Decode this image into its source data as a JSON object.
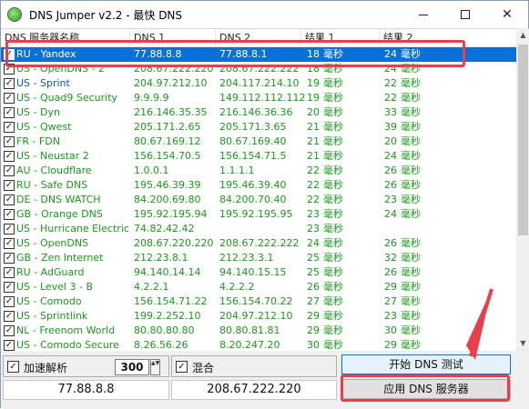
{
  "window": {
    "title": "DNS Jumper v2.2 - 最快 DNS",
    "min_label": "",
    "max_label": "",
    "close_label": "✕"
  },
  "columns": {
    "name": "DNS 服务器名称",
    "dns1": "DNS 1",
    "dns2": "DNS 2",
    "result1": "结果 1",
    "result2": "结果 2"
  },
  "rows": [
    {
      "name": "RU - Yandex",
      "dns1": "77.88.8.8",
      "dns2": "77.88.8.1",
      "r1": "18",
      "r1u": "毫秒",
      "r2": "24",
      "r2u": "毫秒",
      "checked": true,
      "selected": true
    },
    {
      "name": "US - OpenDNS - 2",
      "dns1": "208.67.222.220",
      "dns2": "208.67.222.222",
      "r1": "18",
      "r1u": "毫秒",
      "r2": "24",
      "r2u": "毫秒",
      "checked": true
    },
    {
      "name": "US - Sprint",
      "dns1": "204.97.212.10",
      "dns2": "204.117.214.10",
      "r1": "19",
      "r1u": "毫秒",
      "r2": "22",
      "r2u": "毫秒",
      "checked": true
    },
    {
      "name": "US - Quad9 Security",
      "dns1": "9.9.9.9",
      "dns2": "149.112.112.112",
      "r1": "19",
      "r1u": "毫秒",
      "r2": "22",
      "r2u": "毫秒",
      "checked": true
    },
    {
      "name": "US - Dyn",
      "dns1": "216.146.35.35",
      "dns2": "216.146.36.36",
      "r1": "20",
      "r1u": "毫秒",
      "r2": "33",
      "r2u": "毫秒",
      "checked": true
    },
    {
      "name": "US - Qwest",
      "dns1": "205.171.2.65",
      "dns2": "205.171.3.65",
      "r1": "21",
      "r1u": "毫秒",
      "r2": "39",
      "r2u": "毫秒",
      "checked": true
    },
    {
      "name": "FR - FDN",
      "dns1": "80.67.169.12",
      "dns2": "80.67.169.40",
      "r1": "21",
      "r1u": "毫秒",
      "r2": "20",
      "r2u": "毫秒",
      "checked": true
    },
    {
      "name": "US - Neustar 2",
      "dns1": "156.154.70.5",
      "dns2": "156.154.71.5",
      "r1": "21",
      "r1u": "毫秒",
      "r2": "24",
      "r2u": "毫秒",
      "checked": true
    },
    {
      "name": "AU - Cloudflare",
      "dns1": "1.0.0.1",
      "dns2": "1.1.1.1",
      "r1": "22",
      "r1u": "毫秒",
      "r2": "26",
      "r2u": "毫秒",
      "checked": true
    },
    {
      "name": "RU - Safe DNS",
      "dns1": "195.46.39.39",
      "dns2": "195.46.39.40",
      "r1": "22",
      "r1u": "毫秒",
      "r2": "26",
      "r2u": "毫秒",
      "checked": true
    },
    {
      "name": "DE - DNS WATCH",
      "dns1": "84.200.69.80",
      "dns2": "84.200.70.40",
      "r1": "22",
      "r1u": "毫秒",
      "r2": "23",
      "r2u": "毫秒",
      "checked": true
    },
    {
      "name": "GB - Orange DNS",
      "dns1": "195.92.195.94",
      "dns2": "195.92.195.95",
      "r1": "23",
      "r1u": "毫秒",
      "r2": "24",
      "r2u": "毫秒",
      "checked": true
    },
    {
      "name": "US - Hurricane Electric",
      "dns1": "74.82.42.42",
      "dns2": "",
      "r1": "23",
      "r1u": "毫秒",
      "r2": "",
      "r2u": "",
      "checked": true
    },
    {
      "name": "US - OpenDNS",
      "dns1": "208.67.220.220",
      "dns2": "208.67.222.222",
      "r1": "24",
      "r1u": "毫秒",
      "r2": "26",
      "r2u": "毫秒",
      "checked": true
    },
    {
      "name": "GB - Zen Internet",
      "dns1": "212.23.8.1",
      "dns2": "212.23.3.1",
      "r1": "25",
      "r1u": "毫秒",
      "r2": "32",
      "r2u": "毫秒",
      "checked": true
    },
    {
      "name": "RU - AdGuard",
      "dns1": "94.140.14.14",
      "dns2": "94.140.15.15",
      "r1": "25",
      "r1u": "毫秒",
      "r2": "26",
      "r2u": "毫秒",
      "checked": true
    },
    {
      "name": "US - Level 3 - B",
      "dns1": "4.2.2.1",
      "dns2": "4.2.2.2",
      "r1": "26",
      "r1u": "毫秒",
      "r2": "29",
      "r2u": "毫秒",
      "checked": true
    },
    {
      "name": "US - Comodo",
      "dns1": "156.154.71.22",
      "dns2": "156.154.70.22",
      "r1": "27",
      "r1u": "毫秒",
      "r2": "27",
      "r2u": "毫秒",
      "checked": true
    },
    {
      "name": "US - Sprintlink",
      "dns1": "199.2.252.10",
      "dns2": "204.97.212.10",
      "r1": "29",
      "r1u": "毫秒",
      "r2": "23",
      "r2u": "毫秒",
      "checked": true
    },
    {
      "name": "NL - Freenom World",
      "dns1": "80.80.80.80",
      "dns2": "80.80.81.81",
      "r1": "29",
      "r1u": "毫秒",
      "r2": "30",
      "r2u": "毫秒",
      "checked": true
    },
    {
      "name": "US - Comodo Secure",
      "dns1": "8.26.56.26",
      "dns2": "8.20.247.20",
      "r1": "30",
      "r1u": "毫秒",
      "r2": "29",
      "r2u": "毫秒",
      "checked": true
    }
  ],
  "bottom": {
    "accel_label": "加速解析",
    "accel_checked": "✓",
    "spin_value": "300",
    "spin_arrows": "▲▼",
    "mix_label": "混合",
    "mix_checked": "✓",
    "ip1": "77.88.8.8",
    "ip2": "208.67.222.220",
    "test_button": "开始 DNS 测试",
    "apply_button": "应用 DNS 服务器"
  },
  "scrollbar": {
    "up": "▲",
    "down": "▼"
  },
  "colors": {
    "selected_row": "#0a6fd6",
    "result_green": "#1a9a1a",
    "annotation_red": "#e8404a",
    "focus_blue": "#0078d7"
  }
}
